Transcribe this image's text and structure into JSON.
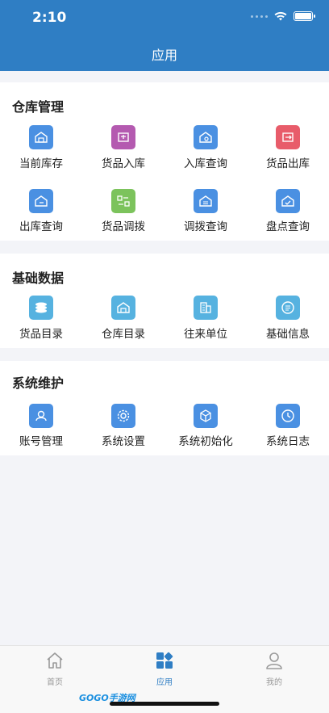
{
  "status_bar": {
    "time": "2:10"
  },
  "header": {
    "title": "应用"
  },
  "sections": [
    {
      "title": "仓库管理",
      "items": [
        {
          "label": "当前库存",
          "icon": "warehouse-icon",
          "color": "#4a90e2"
        },
        {
          "label": "货品入库",
          "icon": "goods-in-icon",
          "color": "#b45ab0"
        },
        {
          "label": "入库查询",
          "icon": "warehouse-search-icon",
          "color": "#4a90e2"
        },
        {
          "label": "货品出库",
          "icon": "goods-out-icon",
          "color": "#e85c6a"
        },
        {
          "label": "出库查询",
          "icon": "outbound-search-icon",
          "color": "#4a90e2"
        },
        {
          "label": "货品调拨",
          "icon": "transfer-icon",
          "color": "#7cc35c"
        },
        {
          "label": "调拨查询",
          "icon": "transfer-search-icon",
          "color": "#4a90e2"
        },
        {
          "label": "盘点查询",
          "icon": "inventory-check-icon",
          "color": "#4a90e2"
        }
      ]
    },
    {
      "title": "基础数据",
      "items": [
        {
          "label": "货品目录",
          "icon": "stack-icon",
          "color": "#56b2e0"
        },
        {
          "label": "仓库目录",
          "icon": "warehouse-list-icon",
          "color": "#56b2e0"
        },
        {
          "label": "往来单位",
          "icon": "building-icon",
          "color": "#56b2e0"
        },
        {
          "label": "基础信息",
          "icon": "info-list-icon",
          "color": "#56b2e0"
        }
      ]
    },
    {
      "title": "系统维护",
      "items": [
        {
          "label": "账号管理",
          "icon": "account-icon",
          "color": "#4a90e2"
        },
        {
          "label": "系统设置",
          "icon": "gear-icon",
          "color": "#4a90e2"
        },
        {
          "label": "系统初始化",
          "icon": "cube-icon",
          "color": "#4a90e2"
        },
        {
          "label": "系统日志",
          "icon": "clock-icon",
          "color": "#4a90e2"
        }
      ]
    }
  ],
  "tabbar": {
    "tabs": [
      {
        "label": "首页",
        "icon": "home-icon",
        "active": false
      },
      {
        "label": "应用",
        "icon": "apps-icon",
        "active": true
      },
      {
        "label": "我的",
        "icon": "user-icon",
        "active": false
      }
    ],
    "active_color": "#2f7ec4",
    "inactive_color": "#999999"
  },
  "watermark": "GOGO手游网"
}
